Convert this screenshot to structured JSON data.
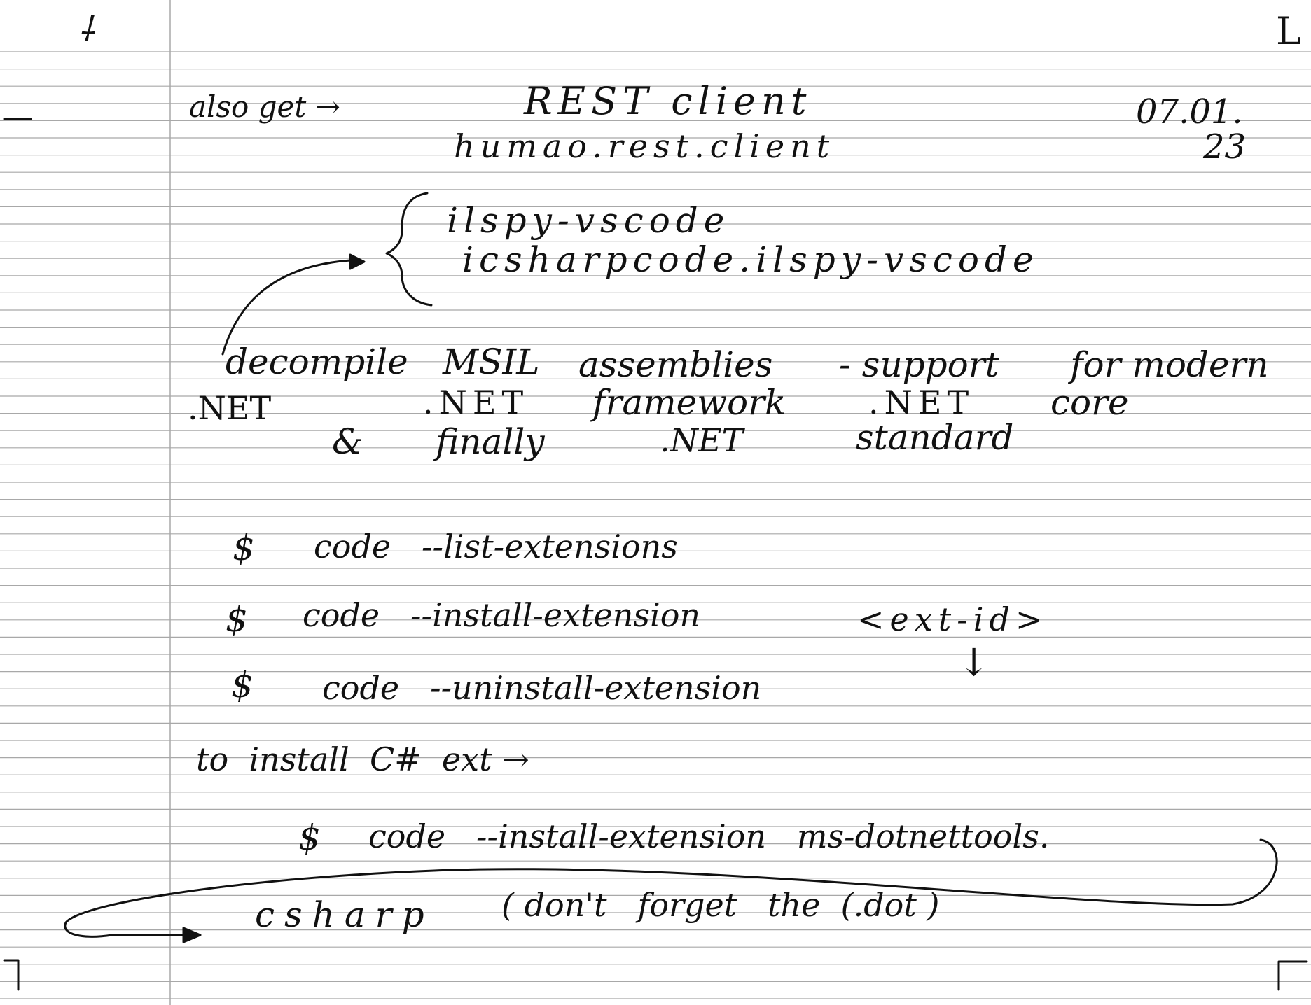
{
  "paper": {
    "background": "#ffffff",
    "rule_color": "#a8a8a8",
    "margin_color": "#a8a8a8",
    "ink_color": "#111111"
  },
  "header": {
    "prefix": "also get →",
    "title": "REST client",
    "extension_id": "humao.rest.client",
    "date_line1": "07.01.",
    "date_line2": "23"
  },
  "ilspy": {
    "name": "ilspy-vscode",
    "id": "icsharpcode.ilspy-vscode"
  },
  "description": {
    "line1_a": "decompile",
    "line1_b": "MSIL",
    "line1_c": "assemblies",
    "line1_d": "- support",
    "line1_e": "for modern",
    "line2_a": ".NET",
    "line2_b": ".NET",
    "line2_c": "framework",
    "line2_d": ".NET",
    "line2_e": "core",
    "line3_a": "&",
    "line3_b": "finally",
    "line3_c": ".NET",
    "line3_d": "standard"
  },
  "commands": {
    "prompt": "$",
    "list": "code   --list-extensions",
    "install": "code   --install-extension",
    "install_arg": "<ext-id>",
    "uninstall": "code   --uninstall-extension",
    "arrow": "↓"
  },
  "csharp": {
    "intro": "to  install  C#  ext →",
    "prompt": "$",
    "command": "code   --install-extension   ms-dotnettools.",
    "continuation": "csharp",
    "note": "( don't   forget   the  (.dot )"
  },
  "page_marks": {
    "top_left": "⸸",
    "top_right": "L"
  }
}
